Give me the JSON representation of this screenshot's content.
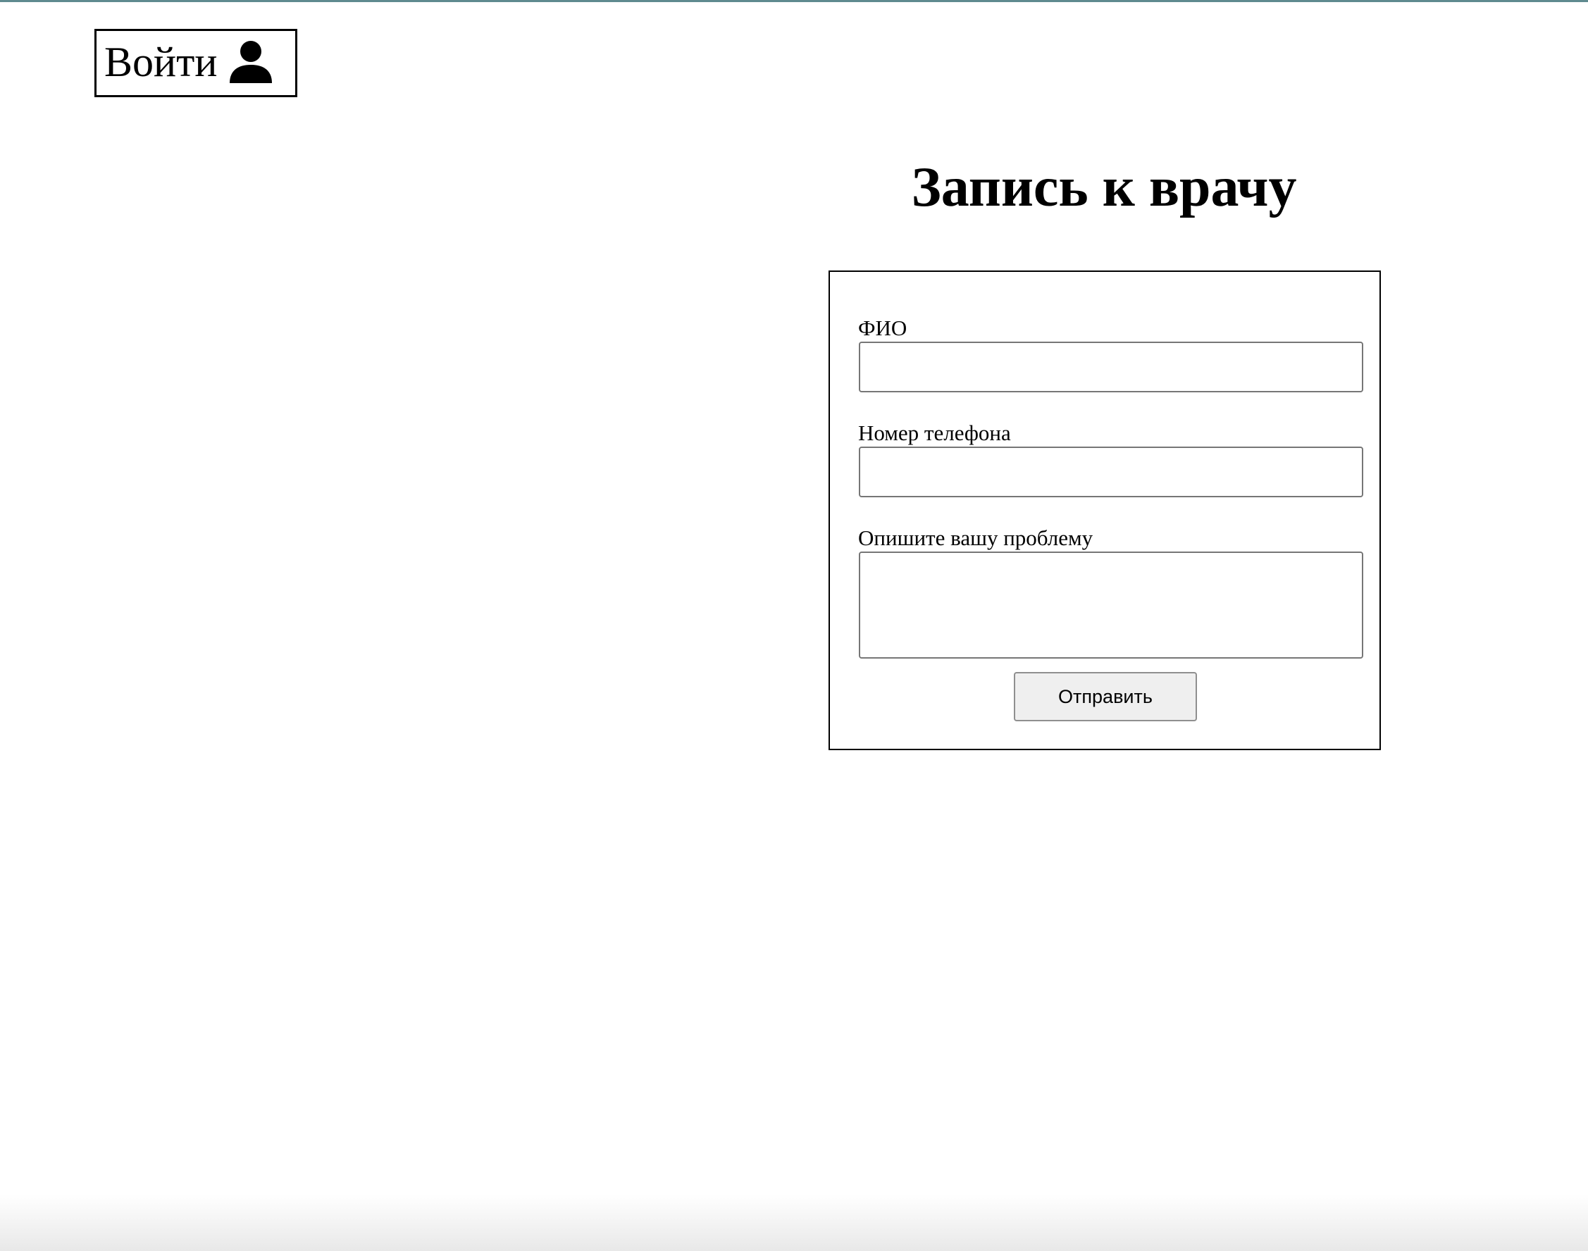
{
  "header": {
    "login_label": "Войти",
    "login_icon": "user-icon"
  },
  "page": {
    "title": "Запись к врачу"
  },
  "form": {
    "fio": {
      "label": "ФИО",
      "value": "",
      "placeholder": ""
    },
    "phone": {
      "label": "Номер телефона",
      "value": "",
      "placeholder": ""
    },
    "problem": {
      "label": "Опишите вашу проблему",
      "value": "",
      "placeholder": ""
    },
    "submit_label": "Отправить"
  },
  "colors": {
    "top_accent": "#5f8a8f",
    "button_bg": "#efefef",
    "input_border": "#767676"
  }
}
